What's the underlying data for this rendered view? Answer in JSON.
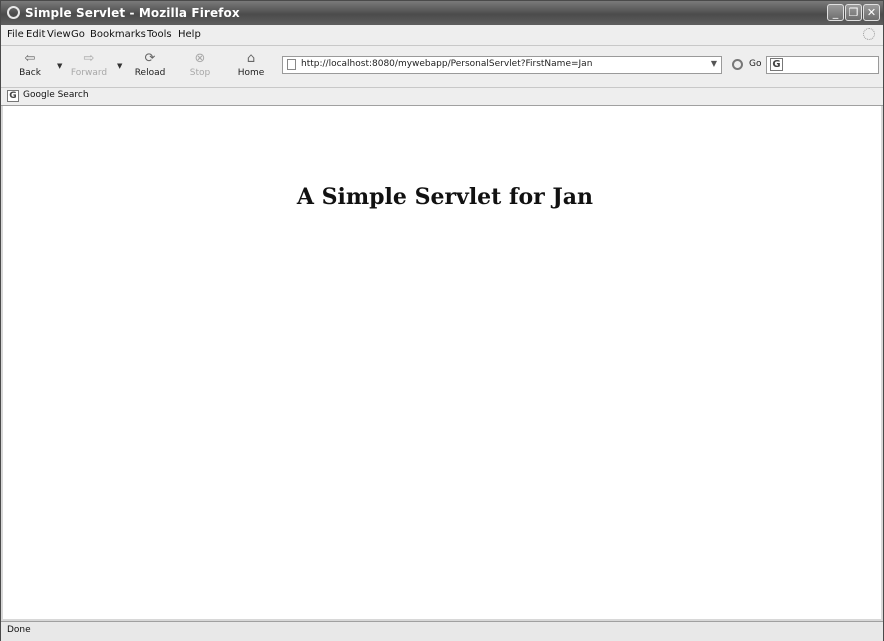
{
  "window": {
    "title": "Simple Servlet - Mozilla Firefox"
  },
  "menu": {
    "file": "File",
    "edit": "Edit",
    "view": "View",
    "go": "Go",
    "bookmarks": "Bookmarks",
    "tools": "Tools",
    "help": "Help"
  },
  "toolbar": {
    "back": "Back",
    "forward": "Forward",
    "reload": "Reload",
    "stop": "Stop",
    "home": "Home",
    "url": "http://localhost:8080/mywebapp/PersonalServlet?FirstName=Jan",
    "go": "Go"
  },
  "bookmarks_bar": {
    "google_search": "Google Search"
  },
  "page": {
    "heading": "A Simple Servlet for Jan"
  },
  "status": {
    "text": "Done"
  }
}
